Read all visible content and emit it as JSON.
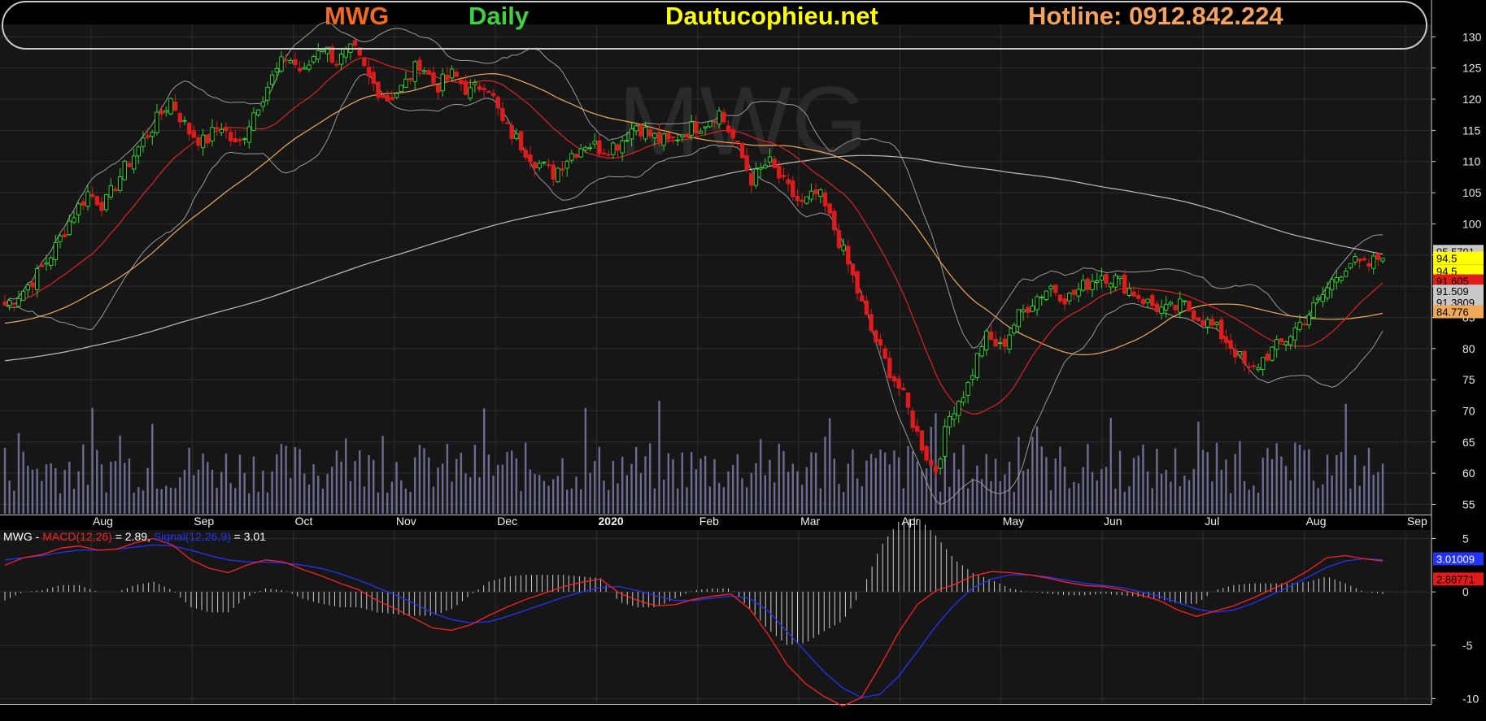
{
  "header": {
    "symbol": "MWG",
    "period": "Daily",
    "site": "Dautucophieu.net",
    "hotline": "Hotline: 0912.842.224"
  },
  "watermark": "MWG",
  "colors": {
    "background": "#000000",
    "panel": "#161616",
    "grid": "#2e2e2e",
    "up": "#2fd12f",
    "down": "#e01b1b",
    "ma_fast": "#e12222",
    "ma_mid": "#f0a95a",
    "ma_slow": "#bdbdbd",
    "bollinger": "#9a9a9a",
    "volume": "#6c6c92",
    "macd": "#ff2020",
    "signal": "#2233ff",
    "histogram": "#d0d0d0"
  },
  "chart_data": [
    {
      "type": "candlestick",
      "x_labels": [
        "Aug",
        "Sep",
        "Oct",
        "Nov",
        "Dec",
        "2020",
        "Feb",
        "Mar",
        "Apr",
        "May",
        "Jun",
        "Jul",
        "Aug",
        "Sep"
      ],
      "y_ticks": [
        130,
        125,
        120,
        115,
        110,
        105,
        100,
        95,
        90,
        85,
        80,
        75,
        70,
        65,
        60,
        55
      ],
      "ylim": [
        53.5,
        132
      ],
      "grid": true,
      "closes": [
        87,
        89,
        92,
        96,
        101,
        105,
        103,
        108,
        112,
        116,
        120,
        115,
        113,
        116,
        112,
        118,
        123,
        127,
        124,
        129,
        126,
        128,
        123,
        120,
        122,
        126,
        122,
        124,
        121,
        123,
        116,
        113,
        110,
        108,
        111,
        113,
        112,
        113,
        116,
        114,
        113,
        115,
        116,
        118,
        113,
        107,
        110,
        106,
        103,
        105,
        99,
        92,
        84,
        78,
        73,
        66,
        60,
        70,
        74,
        82,
        80,
        85,
        88,
        90,
        88,
        90,
        92,
        91,
        89,
        87,
        86,
        87,
        85,
        83,
        80,
        76,
        79,
        81,
        84,
        87,
        91,
        94,
        93,
        95
      ],
      "volume_range": [
        0,
        75
      ],
      "price_labels": [
        {
          "text": "95.5791",
          "value": 95.58,
          "bg": "#c8c8c8",
          "fg": "#000000"
        },
        {
          "text": "94.5",
          "value": 94.5,
          "bg": "#ffff00",
          "fg": "#000000"
        },
        {
          "text": "94.5",
          "value": 92.4,
          "bg": "#ffff00",
          "fg": "#000000"
        },
        {
          "text": "91.605",
          "value": 90.85,
          "bg": "#e01b1b",
          "fg": "#000000"
        },
        {
          "text": "91.509",
          "value": 89.2,
          "bg": "#c8c8c8",
          "fg": "#000000"
        },
        {
          "text": "91.3809",
          "value": 87.4,
          "bg": "#c8c8c8",
          "fg": "#000000"
        },
        {
          "text": "84.776",
          "value": 85.9,
          "bg": "#f0a95a",
          "fg": "#000000"
        }
      ]
    },
    {
      "type": "line",
      "title": "MWG - MACD(12,26) = 2.89, Signal(12,26,9) = 3.01",
      "legend": {
        "prefix": "MWG - ",
        "macd": "MACD(12,26)",
        "macd_val": " = 2.89, ",
        "signal": "Signal(12,26,9)",
        "signal_val": " = 3.01"
      },
      "y_ticks": [
        5,
        0,
        -5,
        -10
      ],
      "ylim": [
        -10.5,
        5.8
      ],
      "macd": [
        2.5,
        3.2,
        3.5,
        4.1,
        4.3,
        3.9,
        4.0,
        4.6,
        5.0,
        4.4,
        3.0,
        2.2,
        1.8,
        2.5,
        3.0,
        2.8,
        2.1,
        1.5,
        0.8,
        0.2,
        -0.8,
        -1.6,
        -2.5,
        -3.4,
        -3.6,
        -3.1,
        -2.2,
        -1.4,
        -0.7,
        -0.1,
        0.5,
        0.9,
        1.2,
        -0.1,
        -0.8,
        -1.3,
        -1.2,
        -0.7,
        -0.4,
        -0.2,
        -1.6,
        -4.0,
        -6.8,
        -8.6,
        -9.8,
        -10.7,
        -9.9,
        -7.0,
        -3.8,
        -1.2,
        0.1,
        0.7,
        1.5,
        1.9,
        1.8,
        1.6,
        1.3,
        0.9,
        0.6,
        0.5,
        0.2,
        -0.3,
        -0.8,
        -1.7,
        -2.3,
        -1.8,
        -1.3,
        -0.6,
        0.2,
        1.0,
        2.0,
        3.2,
        3.4,
        3.1,
        2.89
      ],
      "signal": [
        3.0,
        3.2,
        3.4,
        3.7,
        3.9,
        3.9,
        4.0,
        4.2,
        4.4,
        4.3,
        3.9,
        3.4,
        3.0,
        2.8,
        2.8,
        2.7,
        2.5,
        2.2,
        1.7,
        1.1,
        0.4,
        -0.3,
        -1.1,
        -2.0,
        -2.6,
        -2.9,
        -2.8,
        -2.3,
        -1.7,
        -1.1,
        -0.5,
        0.0,
        0.4,
        0.5,
        0.1,
        -0.4,
        -0.8,
        -0.8,
        -0.6,
        -0.4,
        -0.6,
        -1.8,
        -3.7,
        -5.6,
        -7.5,
        -9.0,
        -9.9,
        -9.6,
        -7.9,
        -5.6,
        -3.2,
        -1.2,
        0.4,
        1.2,
        1.6,
        1.6,
        1.4,
        1.1,
        0.8,
        0.6,
        0.4,
        0.0,
        -0.4,
        -1.0,
        -1.6,
        -1.9,
        -1.7,
        -1.1,
        -0.3,
        0.5,
        1.4,
        2.3,
        2.9,
        3.1,
        3.01
      ],
      "axis_labels": [
        {
          "text": "3.01009",
          "value": 3.1,
          "bg": "#2233ff",
          "fg": "#ffffff"
        },
        {
          "text": "2.88771",
          "value": 1.2,
          "bg": "#e01b1b",
          "fg": "#000000"
        }
      ]
    }
  ]
}
